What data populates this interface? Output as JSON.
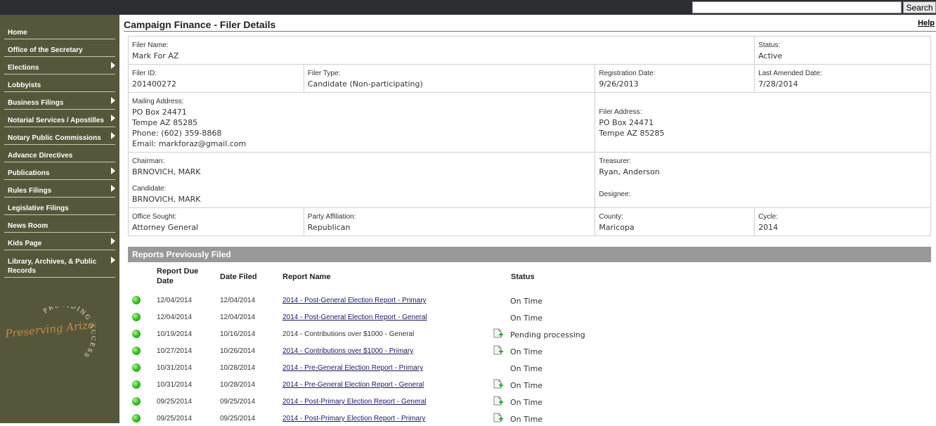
{
  "search": {
    "placeholder": "",
    "button_label": "Search"
  },
  "sidebar": {
    "items": [
      {
        "label": "Home",
        "submenu": false
      },
      {
        "label": "Office of the Secretary",
        "submenu": false
      },
      {
        "label": "Elections",
        "submenu": true
      },
      {
        "label": "Lobbyists",
        "submenu": false
      },
      {
        "label": "Business Filings",
        "submenu": true
      },
      {
        "label": "Notarial Services / Apostilles",
        "submenu": true
      },
      {
        "label": "Notary Public Commissions",
        "submenu": true
      },
      {
        "label": "Advance Directives",
        "submenu": false
      },
      {
        "label": "Publications",
        "submenu": true
      },
      {
        "label": "Rules Filings",
        "submenu": true
      },
      {
        "label": "Legislative Filings",
        "submenu": false
      },
      {
        "label": "News Room",
        "submenu": false
      },
      {
        "label": "Kids Page",
        "submenu": true
      },
      {
        "label": "Library, Archives, & Public Records",
        "submenu": true
      }
    ],
    "logo": {
      "script_text": "Preserving Arizona",
      "ring_text": "PROVIDING ACCESS"
    }
  },
  "page": {
    "title": "Campaign Finance - Filer Details",
    "help_label": "Help"
  },
  "filer": {
    "name_label": "Filer Name:",
    "name": "Mark For AZ",
    "status_label": "Status:",
    "status": "Active",
    "id_label": "Filer ID:",
    "id": "201400272",
    "type_label": "Filer Type:",
    "type": "Candidate (Non-participating)",
    "reg_date_label": "Registration Date:",
    "reg_date": "9/26/2013",
    "amended_label": "Last Amended Date:",
    "amended": "7/28/2014",
    "mailing_label": "Mailing Address:",
    "mailing_line1": "PO Box 24471",
    "mailing_line2": "Tempe AZ 85285",
    "phone": "Phone: (602) 359-8868",
    "email": "Email: markforaz@gmail.com",
    "filer_addr_label": "Filer Address:",
    "filer_addr_line1": "PO Box 24471",
    "filer_addr_line2": "Tempe AZ 85285",
    "chairman_label": "Chairman:",
    "chairman": "BRNOVICH, MARK",
    "candidate_label": "Candidate:",
    "candidate": "BRNOVICH, MARK",
    "treasurer_label": "Treasurer:",
    "treasurer": "Ryan, Anderson",
    "designee_label": "Designee:",
    "designee": "",
    "office_label": "Office Sought:",
    "office": "Attorney General",
    "party_label": "Party Affiliation:",
    "party": "Republican",
    "county_label": "County:",
    "county": "Maricopa",
    "cycle_label": "Cycle:",
    "cycle": "2014"
  },
  "reports": {
    "header": "Reports Previously Filed",
    "columns": {
      "due": "Report Due Date",
      "filed": "Date Filed",
      "name": "Report Name",
      "status": "Status"
    },
    "rows": [
      {
        "due": "12/04/2014",
        "filed": "12/04/2014",
        "name": "2014 - Post-General Election Report - Primary",
        "link": true,
        "doc": false,
        "status": "On Time"
      },
      {
        "due": "12/04/2014",
        "filed": "12/04/2014",
        "name": "2014 - Post-General Election Report - General",
        "link": true,
        "doc": false,
        "status": "On Time"
      },
      {
        "due": "10/19/2014",
        "filed": "10/16/2014",
        "name": "2014 - Contributions over $1000 - General",
        "link": false,
        "doc": true,
        "status": "Pending processing"
      },
      {
        "due": "10/27/2014",
        "filed": "10/26/2014",
        "name": "2014 - Contributions over $1000 - Primary",
        "link": true,
        "doc": true,
        "status": "On Time"
      },
      {
        "due": "10/31/2014",
        "filed": "10/28/2014",
        "name": "2014 - Pre-General Election Report - Primary",
        "link": true,
        "doc": false,
        "status": "On Time"
      },
      {
        "due": "10/31/2014",
        "filed": "10/28/2014",
        "name": "2014 - Pre-General Election Report - General",
        "link": true,
        "doc": true,
        "status": "On Time"
      },
      {
        "due": "09/25/2014",
        "filed": "09/25/2014",
        "name": "2014 - Post-Primary Election Report - General",
        "link": true,
        "doc": true,
        "status": "On Time"
      },
      {
        "due": "09/25/2014",
        "filed": "09/25/2014",
        "name": "2014 - Post-Primary Election Report - Primary",
        "link": true,
        "doc": true,
        "status": "On Time"
      }
    ]
  },
  "colors": {
    "sidebar": "#56573a",
    "topbar": "#2b2d33",
    "reports_header": "#999999",
    "status_dot": "#3cc322"
  }
}
